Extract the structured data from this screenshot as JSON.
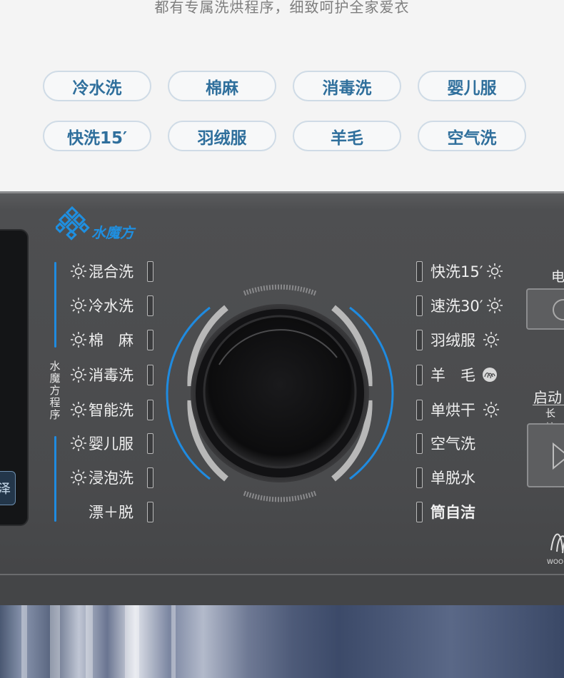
{
  "header": {
    "subtitle": "都有专属洗烘程序，细致呵护全家爱衣"
  },
  "program_pills": [
    {
      "label": "冷水洗"
    },
    {
      "label": "棉麻"
    },
    {
      "label": "消毒洗"
    },
    {
      "label": "婴儿服"
    },
    {
      "label": "快洗15′"
    },
    {
      "label": "羽绒服"
    },
    {
      "label": "羊毛"
    },
    {
      "label": "空气洗"
    }
  ],
  "panel": {
    "brand_logo_text": "水魔方",
    "vertical_label": "水魔方程序",
    "display_button_label": "泽",
    "left_programs": [
      {
        "label": "混合洗",
        "icon": "sun-icon"
      },
      {
        "label": "冷水洗",
        "icon": "sun-icon"
      },
      {
        "label": "棉　麻",
        "icon": "sun-icon"
      },
      {
        "label": "消毒洗",
        "icon": "sun-icon"
      },
      {
        "label": "智能洗",
        "icon": "sun-icon"
      },
      {
        "label": "婴儿服",
        "icon": "sun-icon"
      },
      {
        "label": "浸泡洗",
        "icon": "sun-icon"
      },
      {
        "label": "漂＋脱",
        "icon": ""
      }
    ],
    "right_programs": [
      {
        "label": "快洗15′",
        "icon": "sun-icon"
      },
      {
        "label": "速洗30′",
        "icon": "sun-icon"
      },
      {
        "label": "羽绒服",
        "icon": "sun-icon"
      },
      {
        "label": "羊　毛",
        "icon": "wool-icon"
      },
      {
        "label": "单烘干",
        "icon": "sun-icon"
      },
      {
        "label": "空气洗",
        "icon": ""
      },
      {
        "label": "单脱水",
        "icon": ""
      },
      {
        "label": "筒自洁",
        "icon": ""
      }
    ],
    "power_label": "电",
    "start_label": "启动",
    "start_sublabel": "长按",
    "wool_mark_text": "WOOL",
    "colors": {
      "pill_text": "#2f6f9c",
      "accent_blue": "#1f8be0",
      "panel_bg": "#4a4b4d"
    }
  }
}
